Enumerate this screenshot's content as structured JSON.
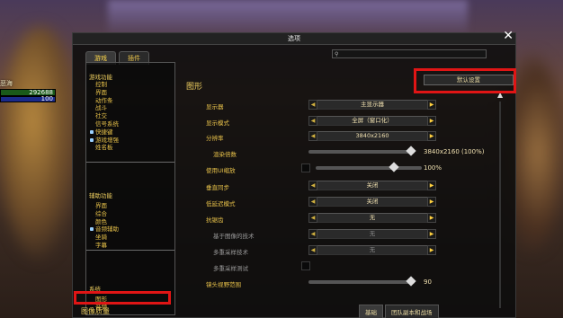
{
  "unit_frame": {
    "name": "恶海",
    "hp": "292688",
    "mp": "100"
  },
  "window": {
    "title": "选项"
  },
  "tabs": [
    {
      "label": "游戏"
    },
    {
      "label": "插件"
    }
  ],
  "search": {
    "placeholder": ""
  },
  "sidebar": {
    "game_title": "游戏功能",
    "game_items": [
      "控制",
      "界面",
      "动作条",
      "战斗",
      "社交",
      "信号系统",
      "快捷键",
      "游戏增强",
      "姓名板"
    ],
    "game_checked": [
      false,
      false,
      false,
      false,
      false,
      false,
      true,
      true,
      false
    ],
    "access_title": "辅助功能",
    "access_items": [
      "界面",
      "综合",
      "颜色",
      "音频辅助",
      "坐骑",
      "字幕"
    ],
    "access_checked": [
      false,
      false,
      false,
      true,
      false,
      false
    ],
    "system_title": "系统",
    "system_items": [
      "图形",
      "音频"
    ]
  },
  "content": {
    "header": "图形",
    "default_button": "默认设置",
    "rows": [
      {
        "label": "显示器",
        "value": "主显示器"
      },
      {
        "label": "显示模式",
        "value": "全屏（窗口化）"
      },
      {
        "label": "分辨率",
        "value": "3840x2160"
      },
      {
        "label": "渲染倍数",
        "value": "3840x2160 (100%)",
        "slider": 0.93
      },
      {
        "label": "使用UI缩放",
        "value": "100%",
        "slider": 0.7
      },
      {
        "label": "垂直同步",
        "value": "关闭"
      },
      {
        "label": "低延迟模式",
        "value": "关闭"
      },
      {
        "label": "抗锯齿",
        "value": "无"
      },
      {
        "label": "基于图像的技术",
        "value": "无"
      },
      {
        "label": "多重采样技术",
        "value": "无"
      },
      {
        "label": "多重采样测试"
      },
      {
        "label": "镜头视野范围",
        "value": "90",
        "slider": 0.93
      }
    ],
    "bottom_label": "图像质量",
    "bottom_tabs": [
      "基础",
      "团队副本和战场"
    ]
  },
  "colors": {
    "accent": "#e8c24a",
    "highlight": "#e01515"
  }
}
